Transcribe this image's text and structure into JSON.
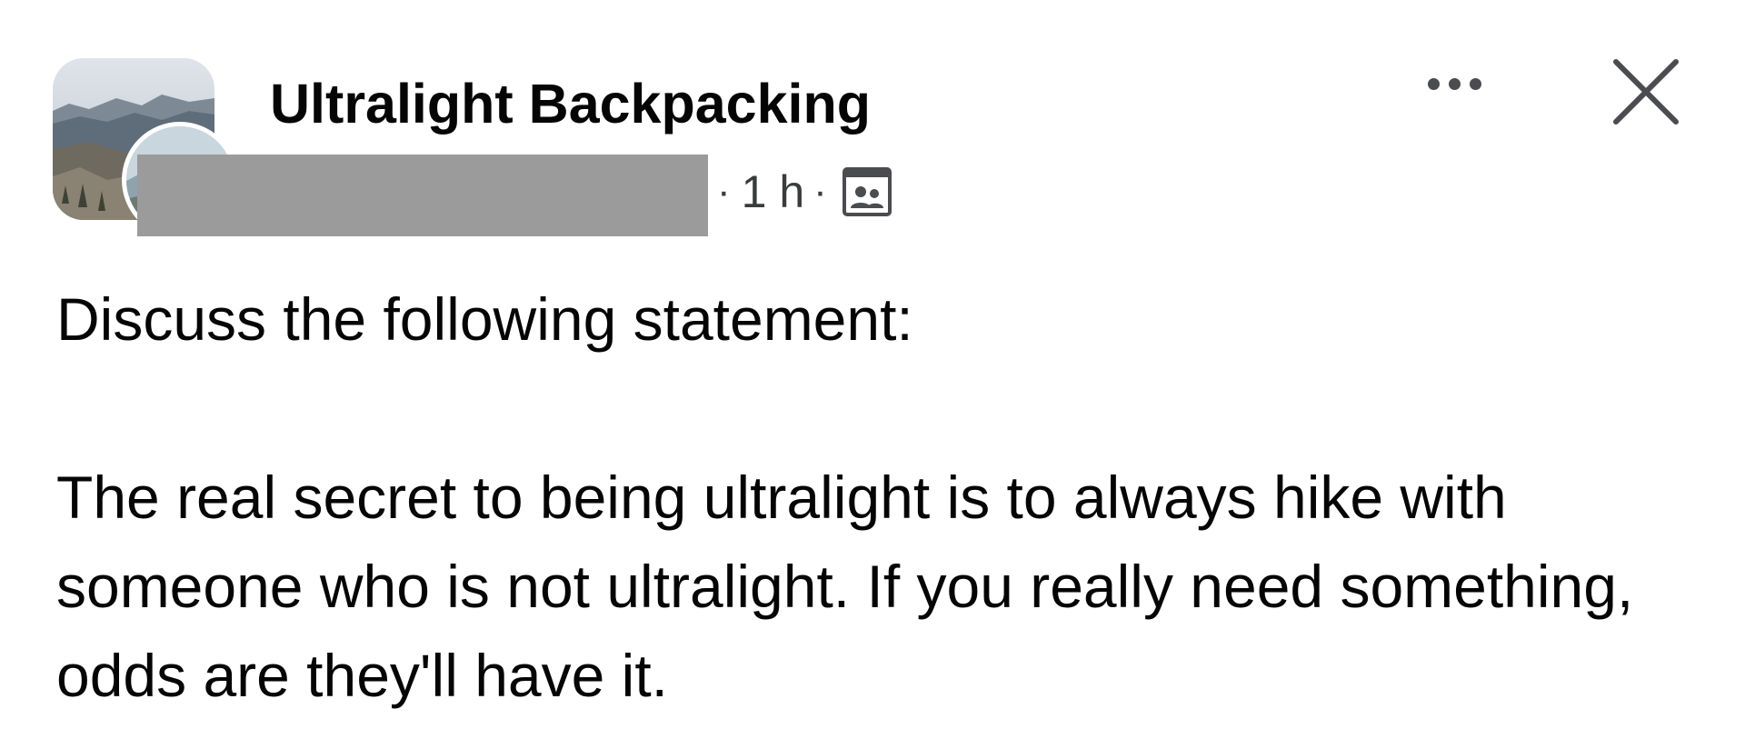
{
  "post": {
    "group_name": "Ultralight Backpacking",
    "meta": {
      "separator": "·",
      "time": "1 h"
    },
    "body": {
      "intro": "Discuss the following statement:",
      "statement": "The real secret to being ultralight is to always hike with someone who is not ultralight. If you really need something, odds are they'll have it."
    }
  },
  "icons": {
    "group_avatar": "mountain-landscape-photo",
    "author_avatar": "profile-photo",
    "audience": "group-members-icon",
    "more": "more-options-icon",
    "close": "close-icon"
  },
  "colors": {
    "text_primary": "#050505",
    "text_secondary": "#3a3b3c",
    "redaction": "#9b9b9b",
    "background": "#ffffff"
  }
}
